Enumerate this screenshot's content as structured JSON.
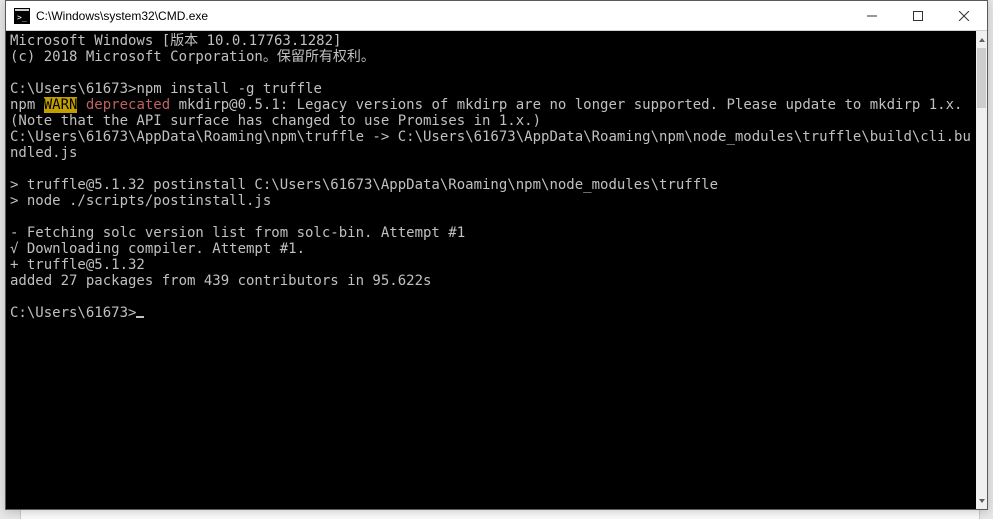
{
  "window": {
    "title": "C:\\Windows\\system32\\CMD.exe"
  },
  "term": {
    "l1": "Microsoft Windows [版本 10.0.17763.1282]",
    "l2": "(c) 2018 Microsoft Corporation。保留所有权利。",
    "blank": "",
    "prompt1a": "C:\\Users\\61673>",
    "prompt1b": "npm install -g truffle",
    "npm_label": "npm ",
    "warn_box": "WARN",
    "warn_sp": " ",
    "deprecated": "deprecated",
    "warn_rest": " mkdirp@0.5.1: Legacy versions of mkdirp are no longer supported. Please update to mkdirp 1.x. (Note that the API surface has changed to use Promises in 1.x.)",
    "link": "C:\\Users\\61673\\AppData\\Roaming\\npm\\truffle -> C:\\Users\\61673\\AppData\\Roaming\\npm\\node_modules\\truffle\\build\\cli.bundled.js",
    "post1": "> truffle@5.1.32 postinstall C:\\Users\\61673\\AppData\\Roaming\\npm\\node_modules\\truffle",
    "post2": "> node ./scripts/postinstall.js",
    "fetch": "- Fetching solc version list from solc-bin. Attempt #1",
    "dlcomp": "√ Downloading compiler. Attempt #1.",
    "plus": "+ truffle@5.1.32",
    "added": "added 27 packages from 439 contributors in 95.622s",
    "prompt2": "C:\\Users\\61673>"
  }
}
